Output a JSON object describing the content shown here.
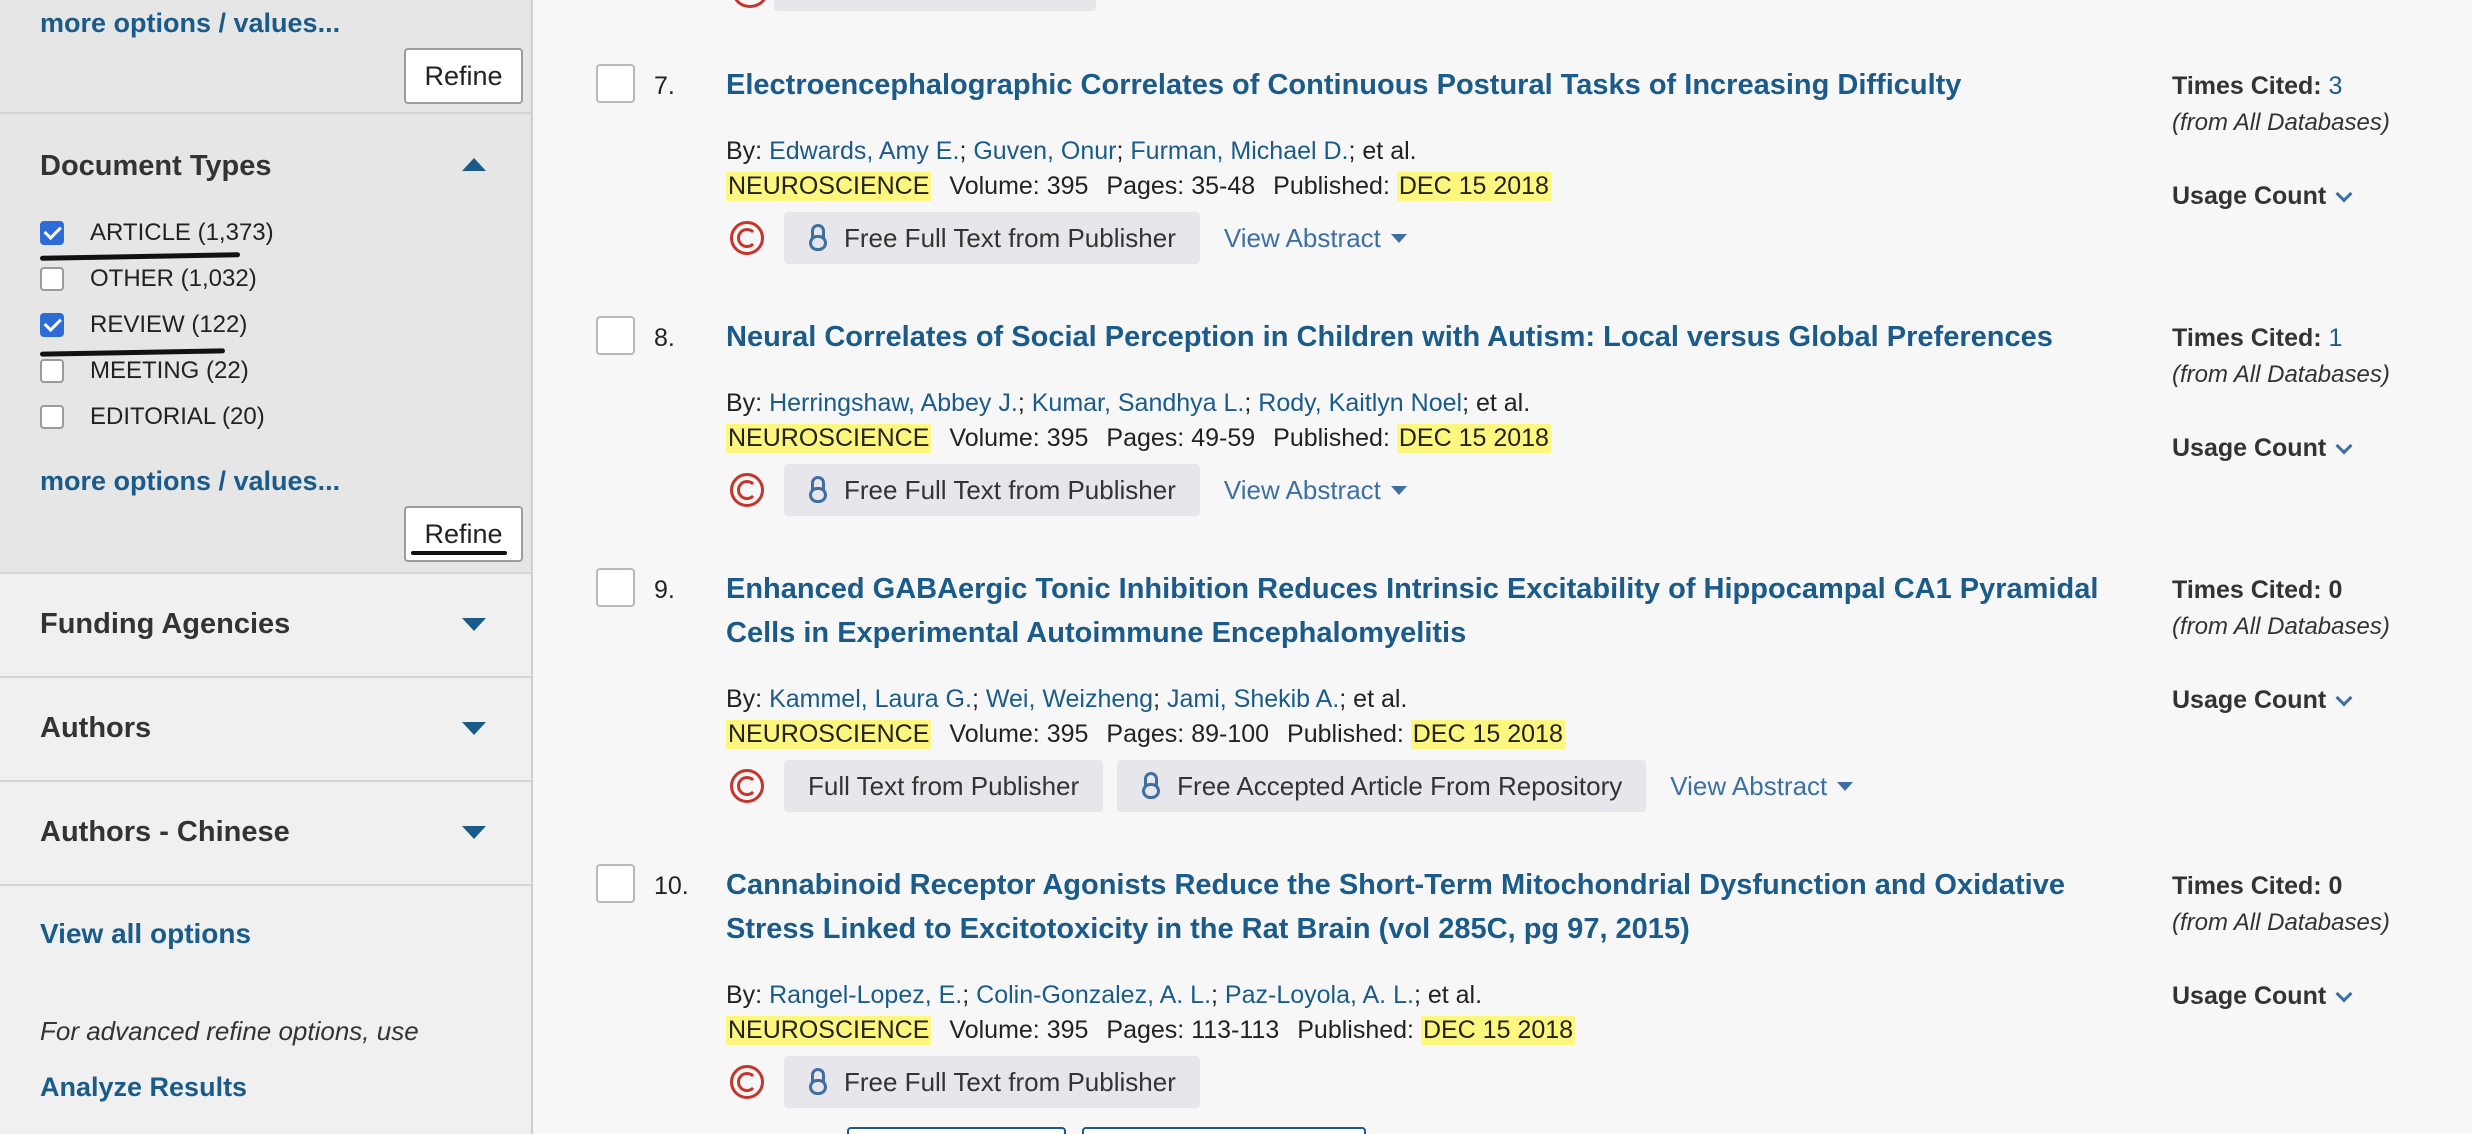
{
  "sidebar": {
    "more_options_top": "more options / values...",
    "refine_top": "Refine",
    "document_types": {
      "title": "Document Types",
      "items": [
        {
          "label": "ARTICLE (1,373)",
          "checked": true
        },
        {
          "label": "OTHER (1,032)",
          "checked": false
        },
        {
          "label": "REVIEW (122)",
          "checked": true
        },
        {
          "label": "MEETING (22)",
          "checked": false
        },
        {
          "label": "EDITORIAL (20)",
          "checked": false
        }
      ],
      "more_options": "more options / values...",
      "refine": "Refine"
    },
    "sections": [
      "Funding Agencies",
      "Authors",
      "Authors - Chinese"
    ],
    "view_all": "View all options",
    "advanced_note": "For advanced refine options, use",
    "analyze": "Analyze Results"
  },
  "results": [
    {
      "num": "7.",
      "title": "Electroencephalographic Correlates of Continuous Postural Tasks of Increasing Difficulty",
      "by": "By:",
      "authors": [
        "Edwards, Amy E.",
        "Guven, Onur",
        "Furman, Michael D."
      ],
      "etal": "; et al.",
      "journal": "NEUROSCIENCE",
      "volume": "Volume: 395",
      "pages": "Pages: 35-48",
      "published_label": "Published:",
      "published": "DEC 15 2018",
      "buttons": [
        {
          "label": "Free Full Text from Publisher",
          "lock": true
        }
      ],
      "view_abstract": "View Abstract",
      "times_cited_label": "Times Cited:",
      "times_cited": "3",
      "from_db": "(from All Databases)",
      "usage": "Usage Count"
    },
    {
      "num": "8.",
      "title": "Neural Correlates of Social Perception in Children with Autism: Local versus Global Preferences",
      "by": "By:",
      "authors": [
        "Herringshaw, Abbey J.",
        "Kumar, Sandhya L.",
        "Rody, Kaitlyn Noel"
      ],
      "etal": "; et al.",
      "journal": "NEUROSCIENCE",
      "volume": "Volume: 395",
      "pages": "Pages: 49-59",
      "published_label": "Published:",
      "published": "DEC 15 2018",
      "buttons": [
        {
          "label": "Free Full Text from Publisher",
          "lock": true
        }
      ],
      "view_abstract": "View Abstract",
      "times_cited_label": "Times Cited:",
      "times_cited": "1",
      "from_db": "(from All Databases)",
      "usage": "Usage Count"
    },
    {
      "num": "9.",
      "title": "Enhanced GABAergic Tonic Inhibition Reduces Intrinsic Excitability of Hippocampal CA1 Pyramidal Cells in Experimental Autoimmune Encephalomyelitis",
      "by": "By:",
      "authors": [
        "Kammel, Laura G.",
        "Wei, Weizheng",
        "Jami, Shekib A."
      ],
      "etal": "; et al.",
      "journal": "NEUROSCIENCE",
      "volume": "Volume: 395",
      "pages": "Pages: 89-100",
      "published_label": "Published:",
      "published": "DEC 15 2018",
      "buttons": [
        {
          "label": "Full Text from Publisher",
          "lock": false
        },
        {
          "label": "Free Accepted Article From Repository",
          "lock": true
        }
      ],
      "view_abstract": "View Abstract",
      "times_cited_label": "Times Cited: 0",
      "times_cited": "",
      "from_db": "(from All Databases)",
      "usage": "Usage Count"
    },
    {
      "num": "10.",
      "title": "Cannabinoid Receptor Agonists Reduce the Short-Term Mitochondrial Dysfunction and Oxidative Stress Linked to Excitotoxicity in the Rat Brain (vol 285C, pg 97, 2015)",
      "by": "By:",
      "authors": [
        "Rangel-Lopez, E.",
        "Colin-Gonzalez, A. L.",
        "Paz-Loyola, A. L."
      ],
      "etal": "; et al.",
      "journal": "NEUROSCIENCE",
      "volume": "Volume: 395",
      "pages": "Pages: 113-113",
      "published_label": "Published:",
      "published": "DEC 15 2018",
      "buttons": [
        {
          "label": "Free Full Text from Publisher",
          "lock": true
        }
      ],
      "view_abstract": "",
      "times_cited_label": "Times Cited: 0",
      "times_cited": "",
      "from_db": "(from All Databases)",
      "usage": "Usage Count"
    }
  ],
  "colors": {
    "link": "#1a5b8a",
    "highlight": "#fdf67f",
    "checkbox": "#2d6bd6"
  }
}
